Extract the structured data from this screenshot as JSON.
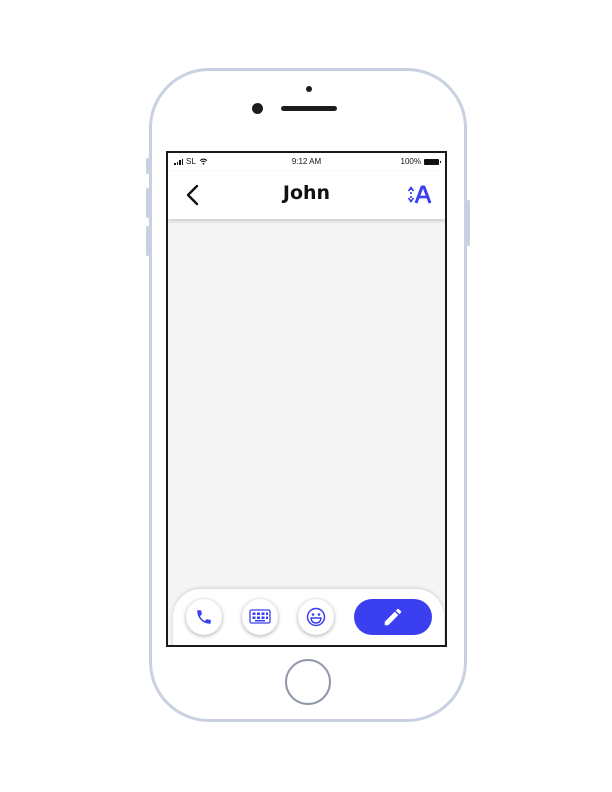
{
  "status_bar": {
    "carrier": "SL",
    "time": "9:12 AM",
    "battery": "100%"
  },
  "header": {
    "back_icon": "chevron-left-icon",
    "title": "John",
    "action_icon": "sort-alphabetical-icon"
  },
  "toolbar": {
    "buttons": [
      {
        "icon": "phone-icon"
      },
      {
        "icon": "keyboard-icon"
      },
      {
        "icon": "emoji-icon"
      },
      {
        "icon": "pencil-icon"
      }
    ]
  },
  "colors": {
    "accent": "#3a3ff0",
    "background": "#f5f5f5",
    "phone_frame": "#c9d1e0"
  }
}
